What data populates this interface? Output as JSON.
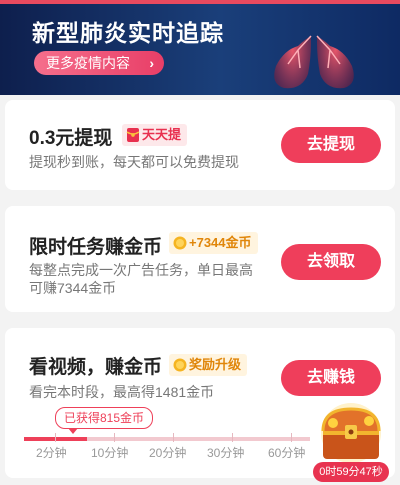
{
  "banner": {
    "title": "新型肺炎实时追踪",
    "more_label": "更多疫情内容",
    "chevron": "›"
  },
  "cards": [
    {
      "title": "0.3元提现",
      "badge": "天天提",
      "subtitle": "提现秒到账，每天都可以免费提现",
      "button": "去提现"
    },
    {
      "title": "限时任务赚金币",
      "badge": "+7344金币",
      "subtitle_line1": "每整点完成一次广告任务，单日最高",
      "subtitle_line2": "可赚7344金币",
      "button": "去领取"
    },
    {
      "title": "看视频，赚金币",
      "badge": "奖励升级",
      "subtitle": "看完本时段，最高得1481金币",
      "button": "去赚钱",
      "earned": "已获得815金币",
      "progress_percent": 22,
      "ticks": [
        "2分钟",
        "10分钟",
        "20分钟",
        "30分钟",
        "60分钟"
      ]
    }
  ],
  "timer": "0时59分47秒",
  "colors": {
    "accent": "#ef3e5b",
    "banner_bg": "#0e1f4d",
    "gold": "#e0860a"
  },
  "icons": {
    "badge1": "red-envelope-icon",
    "badge2": "coin-icon",
    "badge3": "coin-icon",
    "chest": "treasure-chest-icon",
    "banner": "lungs-icon"
  }
}
